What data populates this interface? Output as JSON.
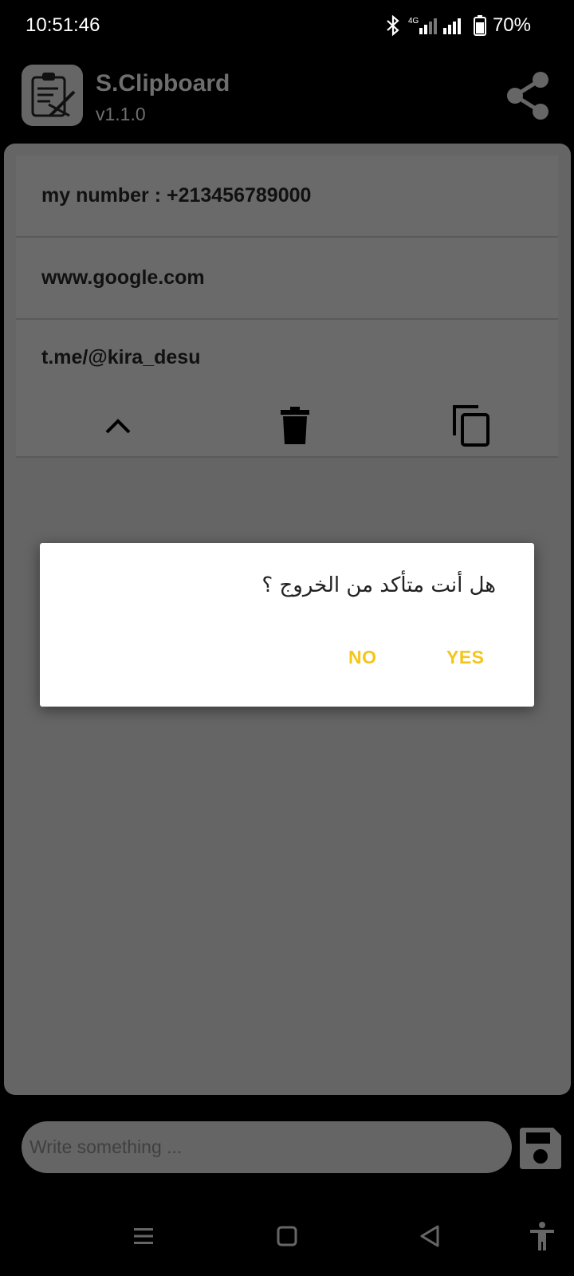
{
  "status_bar": {
    "time": "10:51:46",
    "network": "4G",
    "battery": "70%"
  },
  "app": {
    "title": "S.Clipboard",
    "version": "v1.1.0"
  },
  "clipboard_items": [
    {
      "text": "my number : +213456789000"
    },
    {
      "text": "www.google.com"
    },
    {
      "text": "t.me/@kira_desu"
    }
  ],
  "dialog": {
    "message": "هل أنت متأكد من الخروج ؟",
    "no_label": "NO",
    "yes_label": "YES"
  },
  "input": {
    "placeholder": "Write something ..."
  },
  "colors": {
    "accent": "#f5c518",
    "overlay_card": "#656565",
    "background": "#000000"
  }
}
